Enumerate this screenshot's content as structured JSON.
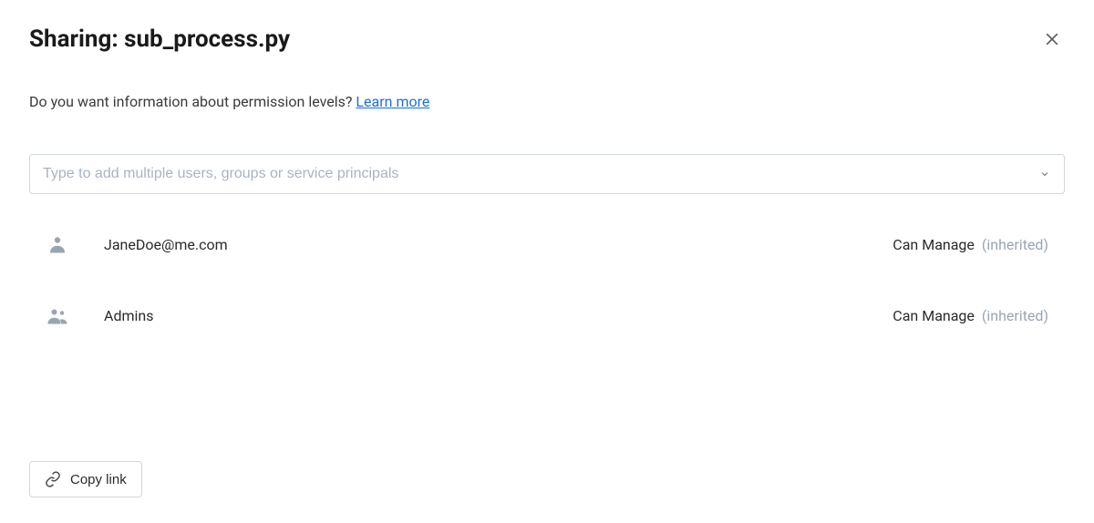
{
  "header": {
    "title": "Sharing: sub_process.py"
  },
  "info": {
    "question": "Do you want information about permission levels? ",
    "learn_more": "Learn more"
  },
  "input": {
    "placeholder": "Type to add multiple users, groups or service principals"
  },
  "permissions": [
    {
      "name": "JaneDoe@me.com",
      "level": "Can Manage",
      "inherited_label": "(inherited)",
      "icon": "user"
    },
    {
      "name": "Admins",
      "level": "Can Manage",
      "inherited_label": "(inherited)",
      "icon": "group"
    }
  ],
  "footer": {
    "copy_link": "Copy link"
  }
}
